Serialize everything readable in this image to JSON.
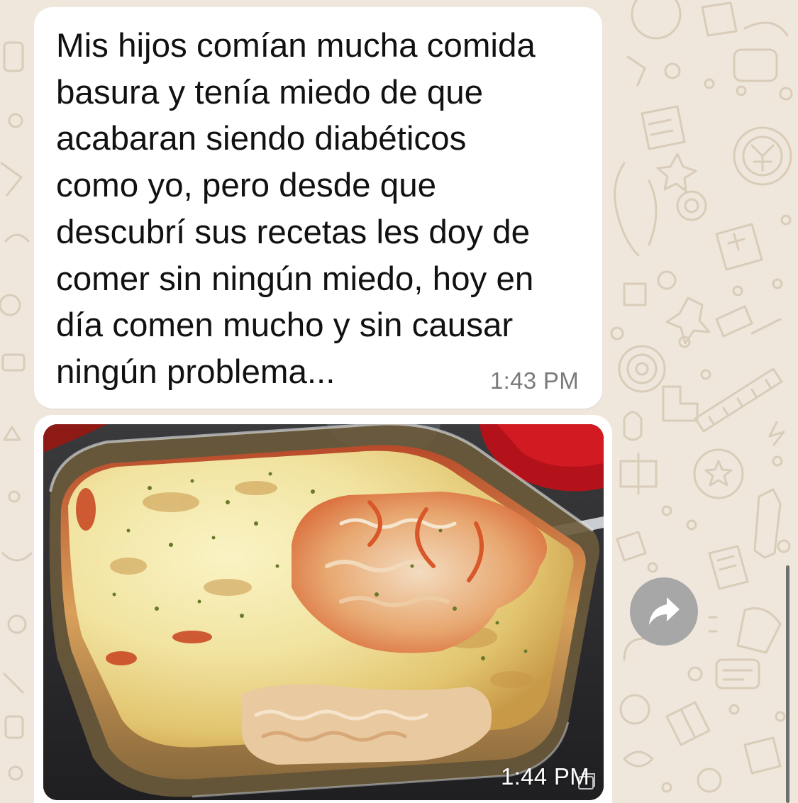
{
  "chat": {
    "messages": [
      {
        "type": "text",
        "text": "Mis hijos comían mucha comida\nbasura y tenía miedo de que\nacabaran siendo diabéticos\ncomo yo, pero desde que\ndescubrí sus recetas les doy de\ncomer sin ningún miedo, hoy en\ndía comen mucho y sin causar\nningún problema...",
        "time": "1:43 PM"
      },
      {
        "type": "image",
        "image_subject": "shredded chicken bake with melted cheese in a glass dish",
        "time": "1:44 PM"
      }
    ],
    "forward_icon": "forward-arrow-icon",
    "media_icon": "media-icon"
  },
  "colors": {
    "wallpaper": "#efe7dc",
    "doodle": "#d9cdb9",
    "bubble": "#ffffff",
    "timestamp": "#7a7a7a",
    "forward_button": "#a7a7a7",
    "scrollbar": "#6f6f6f"
  }
}
